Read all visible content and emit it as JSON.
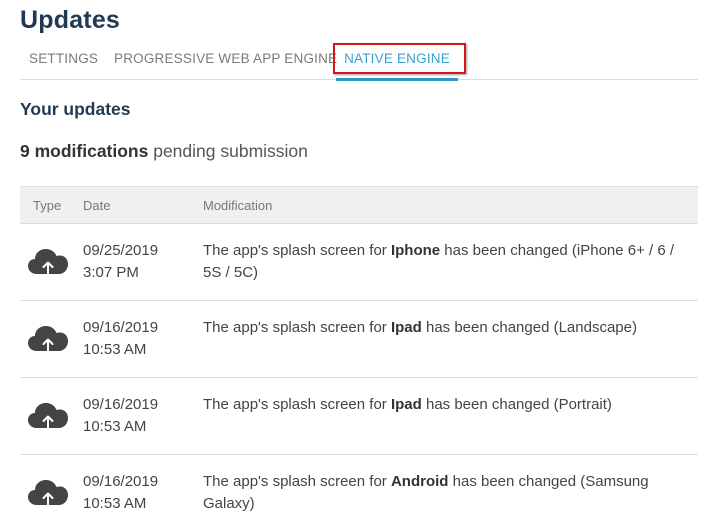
{
  "header": {
    "title": "Updates"
  },
  "tabs": [
    {
      "label": "SETTINGS"
    },
    {
      "label": "PROGRESSIVE WEB APP ENGINE"
    },
    {
      "label": "NATIVE ENGINE"
    }
  ],
  "active_tab": "NATIVE ENGINE",
  "section": {
    "title": "Your updates"
  },
  "pending": {
    "count": "9 modifications",
    "suffix": " pending submission"
  },
  "table": {
    "headers": {
      "type": "Type",
      "date": "Date",
      "modification": "Modification"
    },
    "rows": [
      {
        "icon": "cloud-upload-icon",
        "date": "09/25/2019",
        "time": "3:07 PM",
        "prefix": "The app's splash screen for ",
        "device": "Iphone",
        "suffix": " has been changed (iPhone 6+ / 6 / 5S / 5C)"
      },
      {
        "icon": "cloud-upload-icon",
        "date": "09/16/2019",
        "time": "10:53 AM",
        "prefix": "The app's splash screen for ",
        "device": "Ipad",
        "suffix": " has been changed (Landscape)"
      },
      {
        "icon": "cloud-upload-icon",
        "date": "09/16/2019",
        "time": "10:53 AM",
        "prefix": "The app's splash screen for ",
        "device": "Ipad",
        "suffix": " has been changed (Portrait)"
      },
      {
        "icon": "cloud-upload-icon",
        "date": "09/16/2019",
        "time": "10:53 AM",
        "prefix": "The app's splash screen for ",
        "device": "Android",
        "suffix": " has been changed (Samsung Galaxy)"
      }
    ]
  },
  "colors": {
    "title": "#1f3a52",
    "active_tab": "#3aa0cf",
    "highlight_box": "#d9141b",
    "header_bg": "#f0f0f0"
  }
}
